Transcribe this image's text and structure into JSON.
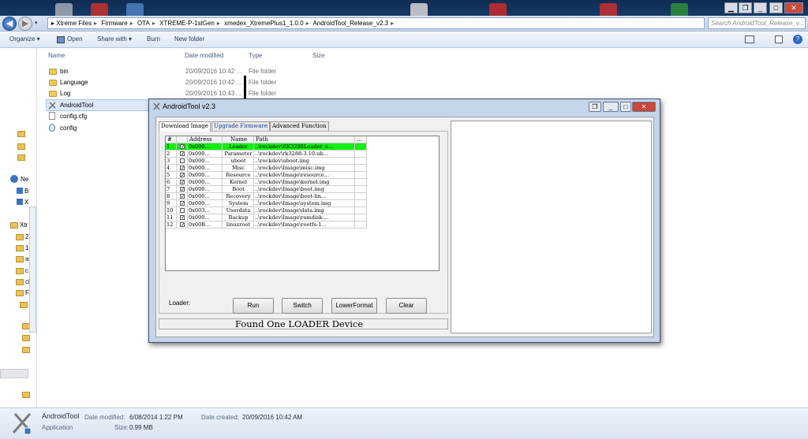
{
  "explorer": {
    "breadcrumbs": [
      "Xtreme Files",
      "Firmware",
      "OTA",
      "XTREME-P-1stGen",
      "xmedex_XtremePlus1_1.0.0",
      "AndroidTool_Release_v2.3"
    ],
    "search_placeholder": "Search AndroidTool_Release_v...",
    "toolbar": {
      "organize": "Organize ▾",
      "open": "Open",
      "share": "Share with ▾",
      "burn": "Burn",
      "new_folder": "New folder"
    },
    "columns": {
      "name": "Name",
      "date": "Date modified",
      "type": "Type",
      "size": "Size"
    },
    "files": [
      {
        "name": "bin",
        "date": "20/09/2016 10:42 ...",
        "type": "File folder"
      },
      {
        "name": "Language",
        "date": "20/09/2016 10:42 ...",
        "type": "File folder"
      },
      {
        "name": "Log",
        "date": "20/09/2016 10:43 ...",
        "type": "File folder"
      },
      {
        "name": "AndroidTool",
        "date": "",
        "type": ""
      },
      {
        "name": "config.cfg",
        "date": "",
        "type": ""
      },
      {
        "name": "config",
        "date": "",
        "type": ""
      }
    ],
    "nav_labels": [
      "Ne",
      "B",
      "X",
      "Xtr",
      "2",
      "1",
      "a",
      "c",
      "cl",
      "Fi"
    ],
    "details": {
      "name": "AndroidTool",
      "kind": "Application",
      "date_modified_label": "Date modified:",
      "date_modified": "6/08/2014 1:22 PM",
      "date_created_label": "Date created:",
      "date_created": "20/09/2016 10:42 AM",
      "size_label": "Size:",
      "size": "0.99 MB"
    }
  },
  "dialog": {
    "title": "AndroidTool v2.3",
    "tabs": [
      "Download Image",
      "Upgrade Firmware",
      "Advanced Function"
    ],
    "grid_headers": [
      "#",
      "",
      "Address",
      "Name",
      "Path",
      "..."
    ],
    "rows": [
      {
        "n": "1",
        "checked": true,
        "addr": "0x000...",
        "name": "Loader",
        "path": "..\\rockdev\\RK3288Loader_u...",
        "hl": true
      },
      {
        "n": "2",
        "checked": true,
        "addr": "0x000...",
        "name": "Parameter",
        "path": "..\\rockdev\\rk3288-3.10-ub..."
      },
      {
        "n": "3",
        "checked": false,
        "addr": "0x000...",
        "name": "uboot",
        "path": "..\\rockdev\\uboot.img"
      },
      {
        "n": "4",
        "checked": true,
        "addr": "0x000...",
        "name": "Misc",
        "path": "..\\rockdev\\Image\\misc.img"
      },
      {
        "n": "5",
        "checked": true,
        "addr": "0x000...",
        "name": "Resource",
        "path": "..\\rockdev\\Image\\resource..."
      },
      {
        "n": "6",
        "checked": true,
        "addr": "0x000...",
        "name": "Kernel",
        "path": "..\\rockdev\\Image\\kernel.img"
      },
      {
        "n": "7",
        "checked": true,
        "addr": "0x000...",
        "name": "Boot",
        "path": "..\\rockdev\\Image\\boot.img"
      },
      {
        "n": "8",
        "checked": true,
        "addr": "0x000...",
        "name": "Recovery",
        "path": "..\\rockdev\\Image\\boot-lin..."
      },
      {
        "n": "9",
        "checked": true,
        "addr": "0x000...",
        "name": "System",
        "path": "..\\rockdev\\Image\\system.img"
      },
      {
        "n": "10",
        "checked": false,
        "addr": "0x003...",
        "name": "Userdata",
        "path": "..\\rockdev\\Image\\data.img"
      },
      {
        "n": "11",
        "checked": true,
        "addr": "0x000...",
        "name": "Backup",
        "path": "..\\rockdev\\Image\\ramdisk-..."
      },
      {
        "n": "12",
        "checked": true,
        "addr": "0x00B...",
        "name": "linuxroot",
        "path": "..\\rockdev\\Image\\rootfs-1..."
      }
    ],
    "loader_label": "Loader:",
    "buttons": [
      "Run",
      "Switch",
      "LowerFormat",
      "Clear"
    ],
    "status": "Found One LOADER Device",
    "highlight_color": "#11f011"
  }
}
